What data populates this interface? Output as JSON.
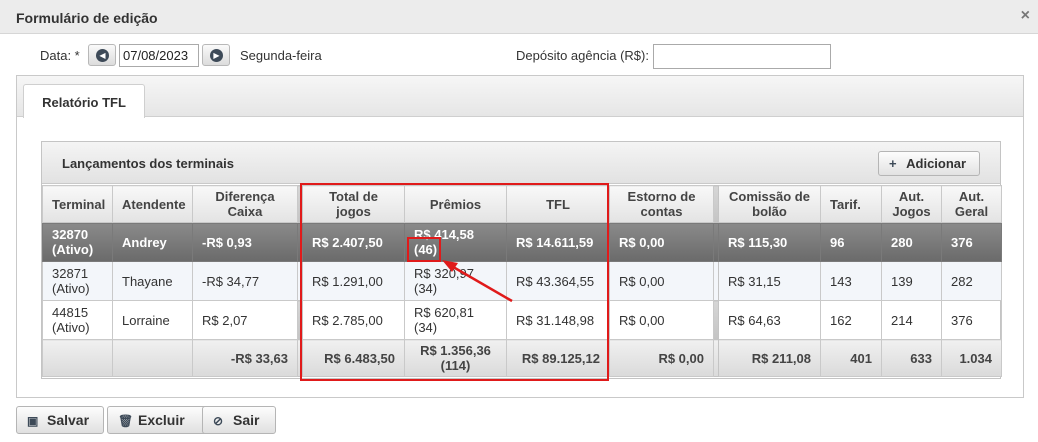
{
  "window": {
    "title": "Formulário de edição",
    "close_glyph": "×"
  },
  "toolbar": {
    "date_label": "Data: *",
    "date_value": "07/08/2023",
    "weekday": "Segunda-feira",
    "deposit_label": "Depósito agência (R$):",
    "deposit_value": "",
    "prev_icon": "◀",
    "next_icon": "▶"
  },
  "tabs": [
    {
      "label": "Relatório TFL"
    }
  ],
  "panel": {
    "title": "Lançamentos dos terminais",
    "add_label": "Adicionar",
    "add_icon": "+"
  },
  "table": {
    "headers": {
      "terminal": "Terminal",
      "atendente": "Atendente",
      "diferenca": "Diferença Caixa",
      "total": "Total de jogos",
      "premios": "Prêmios",
      "tfl": "TFL",
      "estorno": "Estorno de contas",
      "comissao": "Comissão de bolão",
      "tarif": "Tarif.",
      "aut_jogos": "Aut. Jogos",
      "aut_geral": "Aut. Geral"
    },
    "rows": [
      {
        "terminal": "32870 (Ativo)",
        "atendente": "Andrey",
        "diferenca": "-R$ 0,93",
        "total": "R$ 2.407,50",
        "premios_valor": "R$ 414,58",
        "premios_qtd": "(46)",
        "tfl": "R$ 14.611,59",
        "estorno": "R$ 0,00",
        "comissao": "R$ 115,30",
        "tarif": "96",
        "aut_jogos": "280",
        "aut_geral": "376"
      },
      {
        "terminal": "32871 (Ativo)",
        "atendente": "Thayane",
        "diferenca": "-R$ 34,77",
        "total": "R$ 1.291,00",
        "premios_valor": "R$ 320,97",
        "premios_qtd": "(34)",
        "tfl": "R$ 43.364,55",
        "estorno": "R$ 0,00",
        "comissao": "R$ 31,15",
        "tarif": "143",
        "aut_jogos": "139",
        "aut_geral": "282"
      },
      {
        "terminal": "44815 (Ativo)",
        "atendente": "Lorraine",
        "diferenca": "R$ 2,07",
        "total": "R$ 2.785,00",
        "premios_valor": "R$ 620,81",
        "premios_qtd": "(34)",
        "tfl": "R$ 31.148,98",
        "estorno": "R$ 0,00",
        "comissao": "R$ 64,63",
        "tarif": "162",
        "aut_jogos": "214",
        "aut_geral": "376"
      }
    ],
    "totals": {
      "diferenca": "-R$ 33,63",
      "total": "R$ 6.483,50",
      "premios_valor": "R$ 1.356,36",
      "premios_qtd": "(114)",
      "tfl": "R$ 89.125,12",
      "estorno": "R$ 0,00",
      "comissao": "R$ 211,08",
      "tarif": "401",
      "aut_jogos": "633",
      "aut_geral": "1.034"
    }
  },
  "footer": {
    "save_label": "Salvar",
    "save_icon": "▣",
    "delete_label": "Excluir",
    "delete_icon": "🗑",
    "exit_label": "Sair",
    "exit_icon": "⊘"
  },
  "annotation_color": "#e01a1a"
}
